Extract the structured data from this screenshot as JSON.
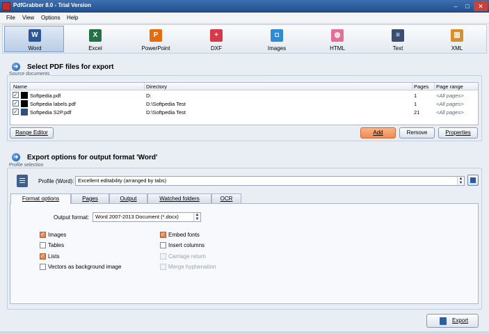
{
  "window": {
    "title": "PdfGrabber 8.0 - Trial Version"
  },
  "menu": [
    "File",
    "View",
    "Options",
    "Help"
  ],
  "formats": [
    {
      "label": "Word",
      "icon": "word-icon",
      "color": "#2b579a",
      "glyph": "W",
      "selected": true
    },
    {
      "label": "Excel",
      "icon": "excel-icon",
      "color": "#217346",
      "glyph": "X"
    },
    {
      "label": "PowerPoint",
      "icon": "powerpoint-icon",
      "color": "#e46c0a",
      "glyph": "P"
    },
    {
      "label": "DXF",
      "icon": "dxf-icon",
      "color": "#d63a4a",
      "glyph": "+"
    },
    {
      "label": "Images",
      "icon": "images-icon",
      "color": "#2e8bd6",
      "glyph": "◘"
    },
    {
      "label": "HTML",
      "icon": "html-icon",
      "color": "#e36f97",
      "glyph": "◍"
    },
    {
      "label": "Text",
      "icon": "text-icon",
      "color": "#3a4f6e",
      "glyph": "≡"
    },
    {
      "label": "XML",
      "icon": "xml-icon",
      "color": "#d6902d",
      "glyph": "▥"
    }
  ],
  "select_section": {
    "title": "Select PDF files for export",
    "group_label": "Source documents",
    "columns": [
      "Name",
      "Directory",
      "Pages",
      "Page range"
    ],
    "rows": [
      {
        "name": "Softpedia.pdf",
        "directory": "D:",
        "pages": "1",
        "range": "<All pages>",
        "swatch": "#000000"
      },
      {
        "name": "Softpedia labels.pdf",
        "directory": "D:\\Softpedia Test",
        "pages": "1",
        "range": "<All pages>",
        "swatch": "#000000"
      },
      {
        "name": "Softpedia S2P.pdf",
        "directory": "D:\\Softpedia Test",
        "pages": "21",
        "range": "<All pages>",
        "swatch": "#2f4f7f"
      }
    ],
    "buttons": {
      "range_editor": "Range Editor",
      "add": "Add",
      "remove": "Remove",
      "properties": "Properties"
    }
  },
  "export_section": {
    "title": "Export options for output format 'Word'",
    "group_label": "Profile selection",
    "profile_label": "Profile (Word):",
    "profile_value": "Excellent editability (arranged by tabs)",
    "tabs": [
      "Format options",
      "Pages",
      "Output",
      "Watched folders",
      "OCR"
    ],
    "output_format_label": "Output format:",
    "output_format_value": "Word 2007-2013 Document (*.docx)",
    "options_left": [
      {
        "label": "Images",
        "checked": true
      },
      {
        "label": "Tables",
        "checked": false
      },
      {
        "label": "Lists",
        "checked": true
      },
      {
        "label": "Vectors as background image",
        "checked": false
      }
    ],
    "options_right": [
      {
        "label": "Embed fonts",
        "checked": true,
        "disabled": false
      },
      {
        "label": "Insert columns",
        "checked": false,
        "disabled": false
      },
      {
        "label": "Carriage return",
        "checked": false,
        "disabled": true
      },
      {
        "label": "Merge hyphenation",
        "checked": false,
        "disabled": true
      }
    ],
    "export_button": "Export"
  }
}
